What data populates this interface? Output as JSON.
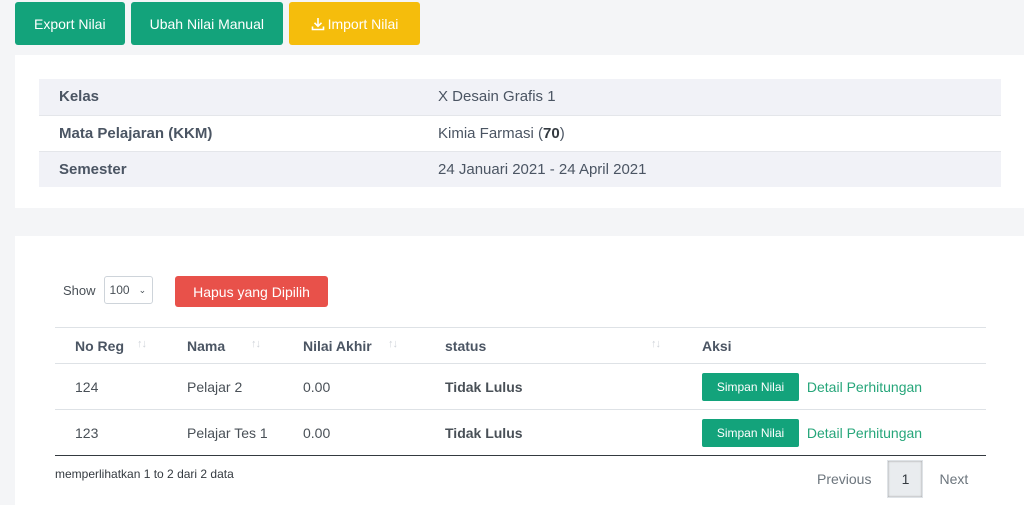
{
  "toolbar": {
    "export_label": "Export Nilai",
    "manual_label": "Ubah Nilai Manual",
    "import_label": "Import Nilai"
  },
  "info": {
    "rows": [
      {
        "label": "Kelas",
        "value": "X Desain Grafis 1"
      },
      {
        "label": "Mata Pelajaran (KKM)",
        "value_prefix": "Kimia Farmasi (",
        "value_bold": "70",
        "value_suffix": ")"
      },
      {
        "label": "Semester",
        "value": "24 Januari 2021 - 24 April 2021"
      }
    ]
  },
  "controls": {
    "show_label": "Show",
    "page_size": "100",
    "delete_selected_label": "Hapus yang Dipilih"
  },
  "table": {
    "headers": [
      "No Reg",
      "Nama",
      "Nilai Akhir",
      "status",
      "Aksi"
    ],
    "rows": [
      {
        "no_reg": "124",
        "nama": "Pelajar 2",
        "nilai": "0.00",
        "status": "Tidak Lulus",
        "save": "Simpan Nilai",
        "detail": "Detail Perhitungan"
      },
      {
        "no_reg": "123",
        "nama": "Pelajar Tes 1",
        "nilai": "0.00",
        "status": "Tidak Lulus",
        "save": "Simpan Nilai",
        "detail": "Detail Perhitungan"
      }
    ]
  },
  "footer": {
    "info_text": "memperlihatkan 1 to 2 dari 2 data",
    "prev_label": "Previous",
    "current_page": "1",
    "next_label": "Next"
  },
  "icons": {
    "sort": "sort-arrows-icon",
    "download": "download-icon",
    "caret": "chevron-down-icon"
  },
  "colors": {
    "primary_green": "#13a37b",
    "warning_yellow": "#f5bd0c",
    "danger_red": "#e8514a",
    "fail_text": "#e04b3d"
  }
}
